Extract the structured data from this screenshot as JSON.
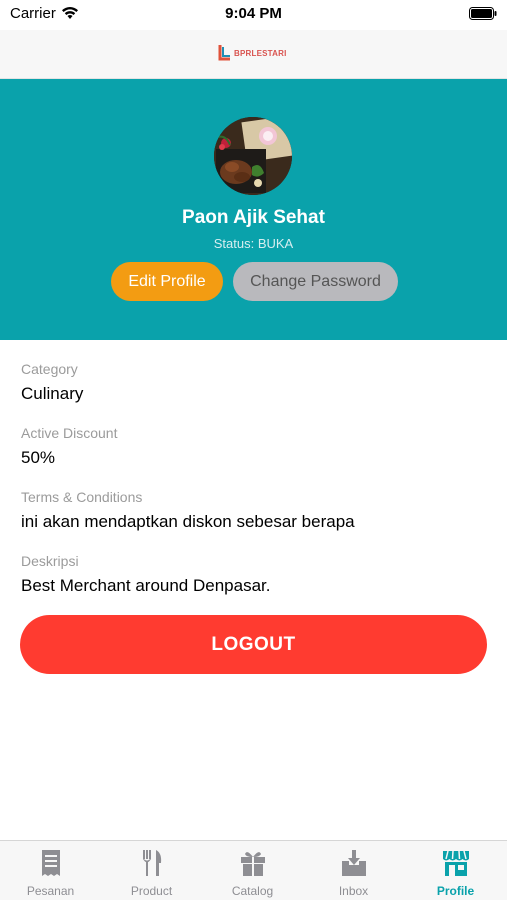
{
  "status_bar": {
    "carrier": "Carrier",
    "time": "9:04 PM"
  },
  "header": {
    "logo_text": "BPRLESTARI"
  },
  "profile": {
    "name": "Paon Ajik Sehat",
    "status": "Status: BUKA",
    "edit_button": "Edit Profile",
    "password_button": "Change Password"
  },
  "details": [
    {
      "label": "Category",
      "value": "Culinary"
    },
    {
      "label": "Active Discount",
      "value": "50%"
    },
    {
      "label": "Terms & Conditions",
      "value": "ini akan mendaptkan diskon sebesar berapa"
    },
    {
      "label": "Deskripsi",
      "value": "Best Merchant around Denpasar."
    }
  ],
  "logout_label": "LOGOUT",
  "tabs": [
    {
      "label": "Pesanan",
      "icon": "receipt-icon"
    },
    {
      "label": "Product",
      "icon": "fork-knife-icon"
    },
    {
      "label": "Catalog",
      "icon": "gift-icon"
    },
    {
      "label": "Inbox",
      "icon": "inbox-download-icon"
    },
    {
      "label": "Profile",
      "icon": "storefront-icon",
      "active": true
    }
  ],
  "colors": {
    "header_bg": "#0aa2ab",
    "edit_button": "#f39c12",
    "password_button": "#b9b9bd",
    "logout": "#ff3b30",
    "active_tab": "#0aa2ab",
    "inactive_tab": "#8e8e93"
  }
}
